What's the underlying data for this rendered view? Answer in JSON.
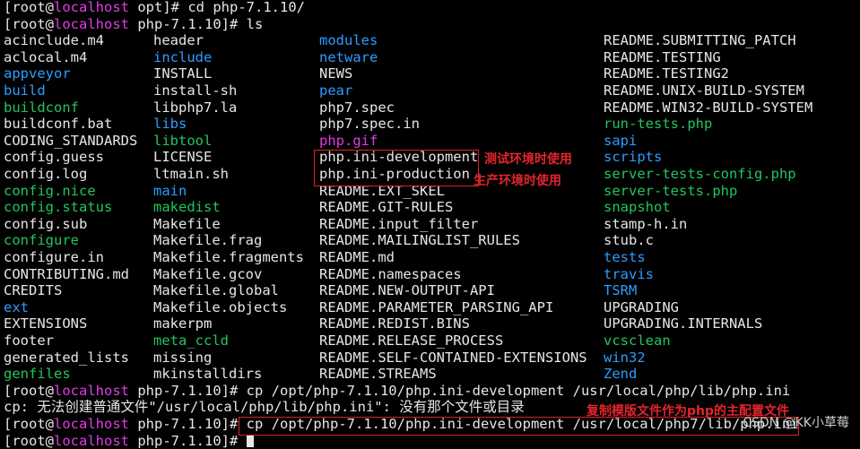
{
  "prompt": {
    "root": "[root@",
    "host": "localhost",
    "sep": " "
  },
  "lines": [
    {
      "dir": "opt]# ",
      "cmd": "cd php-7.1.10/"
    },
    {
      "dir": "php-7.1.10]# ",
      "cmd": "ls"
    }
  ],
  "ls_columns": [
    [
      {
        "name": "acinclude.m4",
        "kind": "white"
      },
      {
        "name": "aclocal.m4",
        "kind": "white"
      },
      {
        "name": "appveyor",
        "kind": "blue"
      },
      {
        "name": "build",
        "kind": "blue"
      },
      {
        "name": "buildconf",
        "kind": "green"
      },
      {
        "name": "buildconf.bat",
        "kind": "white"
      },
      {
        "name": "CODING_STANDARDS",
        "kind": "white"
      },
      {
        "name": "config.guess",
        "kind": "white"
      },
      {
        "name": "config.log",
        "kind": "white"
      },
      {
        "name": "config.nice",
        "kind": "green"
      },
      {
        "name": "config.status",
        "kind": "green"
      },
      {
        "name": "config.sub",
        "kind": "white"
      },
      {
        "name": "configure",
        "kind": "green"
      },
      {
        "name": "configure.in",
        "kind": "white"
      },
      {
        "name": "CONTRIBUTING.md",
        "kind": "white"
      },
      {
        "name": "CREDITS",
        "kind": "white"
      },
      {
        "name": "ext",
        "kind": "blue"
      },
      {
        "name": "EXTENSIONS",
        "kind": "white"
      },
      {
        "name": "footer",
        "kind": "white"
      },
      {
        "name": "generated_lists",
        "kind": "white"
      },
      {
        "name": "genfiles",
        "kind": "green"
      }
    ],
    [
      {
        "name": "header",
        "kind": "white"
      },
      {
        "name": "include",
        "kind": "blue"
      },
      {
        "name": "INSTALL",
        "kind": "white"
      },
      {
        "name": "install-sh",
        "kind": "white"
      },
      {
        "name": "libphp7.la",
        "kind": "white"
      },
      {
        "name": "libs",
        "kind": "blue"
      },
      {
        "name": "libtool",
        "kind": "green"
      },
      {
        "name": "LICENSE",
        "kind": "white"
      },
      {
        "name": "ltmain.sh",
        "kind": "white"
      },
      {
        "name": "main",
        "kind": "blue"
      },
      {
        "name": "makedist",
        "kind": "green"
      },
      {
        "name": "Makefile",
        "kind": "white"
      },
      {
        "name": "Makefile.frag",
        "kind": "white"
      },
      {
        "name": "Makefile.fragments",
        "kind": "white"
      },
      {
        "name": "Makefile.gcov",
        "kind": "white"
      },
      {
        "name": "Makefile.global",
        "kind": "white"
      },
      {
        "name": "Makefile.objects",
        "kind": "white"
      },
      {
        "name": "makerpm",
        "kind": "white"
      },
      {
        "name": "meta_ccld",
        "kind": "green"
      },
      {
        "name": "missing",
        "kind": "white"
      },
      {
        "name": "mkinstalldirs",
        "kind": "white"
      }
    ],
    [
      {
        "name": "modules",
        "kind": "blue"
      },
      {
        "name": "netware",
        "kind": "blue"
      },
      {
        "name": "NEWS",
        "kind": "white"
      },
      {
        "name": "pear",
        "kind": "blue"
      },
      {
        "name": "php7.spec",
        "kind": "white"
      },
      {
        "name": "php7.spec.in",
        "kind": "white"
      },
      {
        "name": "php.gif",
        "kind": "magenta"
      },
      {
        "name": "php.ini-development",
        "kind": "white"
      },
      {
        "name": "php.ini-production",
        "kind": "white"
      },
      {
        "name": "README.EXT_SKEL",
        "kind": "white"
      },
      {
        "name": "README.GIT-RULES",
        "kind": "white"
      },
      {
        "name": "README.input_filter",
        "kind": "white"
      },
      {
        "name": "README.MAILINGLIST_RULES",
        "kind": "white"
      },
      {
        "name": "README.md",
        "kind": "white"
      },
      {
        "name": "README.namespaces",
        "kind": "white"
      },
      {
        "name": "README.NEW-OUTPUT-API",
        "kind": "white"
      },
      {
        "name": "README.PARAMETER_PARSING_API",
        "kind": "white"
      },
      {
        "name": "README.REDIST.BINS",
        "kind": "white"
      },
      {
        "name": "README.RELEASE_PROCESS",
        "kind": "white"
      },
      {
        "name": "README.SELF-CONTAINED-EXTENSIONS",
        "kind": "white"
      },
      {
        "name": "README.STREAMS",
        "kind": "white"
      }
    ],
    [
      {
        "name": "README.SUBMITTING_PATCH",
        "kind": "white"
      },
      {
        "name": "README.TESTING",
        "kind": "white"
      },
      {
        "name": "README.TESTING2",
        "kind": "white"
      },
      {
        "name": "README.UNIX-BUILD-SYSTEM",
        "kind": "white"
      },
      {
        "name": "README.WIN32-BUILD-SYSTEM",
        "kind": "white"
      },
      {
        "name": "run-tests.php",
        "kind": "green"
      },
      {
        "name": "sapi",
        "kind": "blue"
      },
      {
        "name": "scripts",
        "kind": "blue"
      },
      {
        "name": "server-tests-config.php",
        "kind": "green"
      },
      {
        "name": "server-tests.php",
        "kind": "green"
      },
      {
        "name": "snapshot",
        "kind": "green"
      },
      {
        "name": "stamp-h.in",
        "kind": "white"
      },
      {
        "name": "stub.c",
        "kind": "white"
      },
      {
        "name": "tests",
        "kind": "blue"
      },
      {
        "name": "travis",
        "kind": "blue"
      },
      {
        "name": "TSRM",
        "kind": "blue"
      },
      {
        "name": "UPGRADING",
        "kind": "white"
      },
      {
        "name": "UPGRADING.INTERNALS",
        "kind": "white"
      },
      {
        "name": "vcsclean",
        "kind": "green"
      },
      {
        "name": "win32",
        "kind": "blue"
      },
      {
        "name": "Zend",
        "kind": "blue"
      }
    ]
  ],
  "after": [
    {
      "type": "prompt",
      "dir": "php-7.1.10]# ",
      "cmd": "cp /opt/php-7.1.10/php.ini-development /usr/local/php/lib/php.ini"
    },
    {
      "type": "output",
      "text": "cp: 无法创建普通文件\"/usr/local/php/lib/php.ini\": 没有那个文件或目录"
    },
    {
      "type": "prompt",
      "dir": "php-7.1.10]# ",
      "cmd": "cp /opt/php-7.1.10/php.ini-development /usr/local/php7/lib/php.ini"
    },
    {
      "type": "prompt_partial",
      "dir": "php-7.1.10]# ",
      "cmd": ""
    }
  ],
  "annotations": {
    "test_env": "测试环境时使用",
    "prod_env": "生产环境时使用",
    "copy_note": "复制模版文件作为php的主配置文件"
  },
  "watermark": "CSDN @KK小草莓",
  "colors": {
    "white": "#e6e6e6",
    "blue": "#2f9bff",
    "green": "#22c55e",
    "magenta": "#e23be6",
    "red": "#e5252b"
  }
}
